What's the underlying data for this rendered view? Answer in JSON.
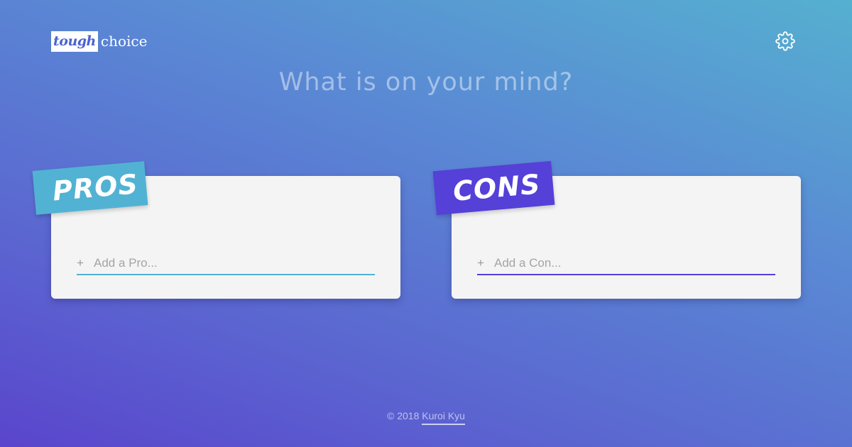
{
  "logo": {
    "tough": "tough",
    "choice": "choice"
  },
  "settings": {
    "icon": "gear-icon"
  },
  "headline": "What is on your mind?",
  "pros": {
    "label": "PROS",
    "input_placeholder": "Add a Pro...",
    "input_value": "",
    "add_icon": "+",
    "accent": "#52b2d3"
  },
  "cons": {
    "label": "CONS",
    "input_placeholder": "Add a Con...",
    "input_value": "",
    "add_icon": "+",
    "accent": "#5540d8"
  },
  "footer": {
    "copyright": "© 2018",
    "author": "Kuroi Kyu"
  },
  "colors": {
    "background_top": "#55b0d0",
    "background_bottom": "#5a45cc",
    "card": "#f4f4f4"
  }
}
